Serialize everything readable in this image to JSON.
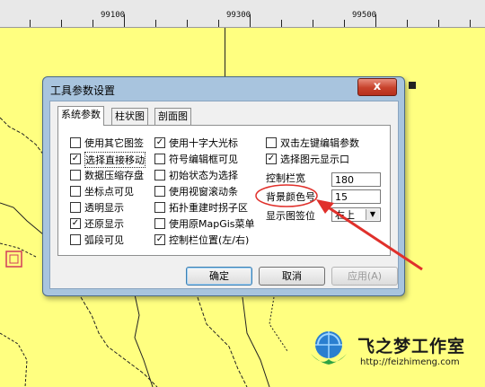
{
  "ruler": {
    "labels": [
      "99100",
      "99300",
      "99500"
    ]
  },
  "dialog": {
    "title": "工具参数设置",
    "close_glyph": "x",
    "tabs": [
      "系统参数",
      "柱状图",
      "剖面图"
    ],
    "col1": [
      {
        "label": "使用其它图签",
        "checked": false
      },
      {
        "label": "选择直接移动",
        "checked": true
      },
      {
        "label": "数据压缩存盘",
        "checked": false
      },
      {
        "label": "坐标点可见",
        "checked": false
      },
      {
        "label": "透明显示",
        "checked": false
      },
      {
        "label": "还原显示",
        "checked": true
      },
      {
        "label": "弧段可见",
        "checked": false
      }
    ],
    "col2": [
      {
        "label": "使用十字大光标",
        "checked": true
      },
      {
        "label": "符号编辑框可见",
        "checked": false
      },
      {
        "label": "初始状态为选择",
        "checked": false
      },
      {
        "label": "使用视窗滚动条",
        "checked": false
      },
      {
        "label": "拓扑重建时拐子区",
        "checked": false
      },
      {
        "label": "使用原MapGis菜单",
        "checked": false
      },
      {
        "label": "控制栏位置(左/右)",
        "checked": true
      }
    ],
    "col3": [
      {
        "label": "双击左键编辑参数",
        "checked": false
      },
      {
        "label": "选择图元显示口",
        "checked": true
      }
    ],
    "fields": {
      "control_width_label": "控制栏宽",
      "control_width_value": "180",
      "bg_color_label": "背景颜色号",
      "bg_color_value": "15",
      "display_pos_label": "显示图签位",
      "display_pos_value": "右上"
    },
    "buttons": {
      "ok": "确定",
      "cancel": "取消",
      "apply": "应用(A)"
    }
  },
  "annotation": {
    "color": "#e0302b"
  },
  "logo": {
    "text": "飞之梦工作室",
    "url": "http://feizhimeng.com"
  }
}
